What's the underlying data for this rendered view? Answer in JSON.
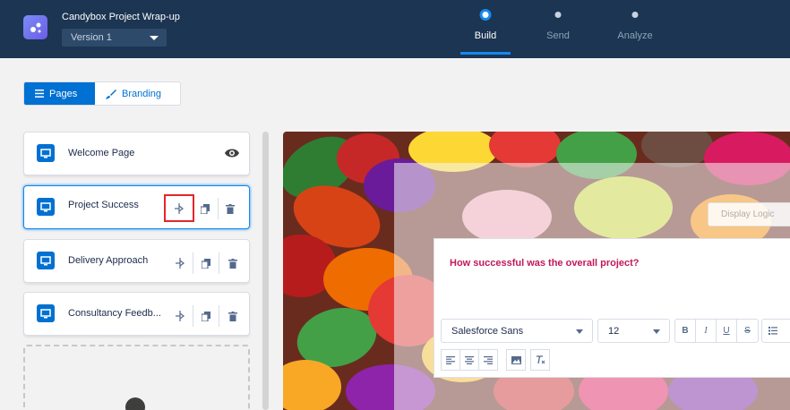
{
  "header": {
    "app_title": "Candybox Project Wrap-up",
    "version": "Version 1",
    "steps": [
      {
        "label": "Build",
        "active": true
      },
      {
        "label": "Send",
        "active": false
      },
      {
        "label": "Analyze",
        "active": false
      }
    ]
  },
  "mode_toggle": {
    "pages_label": "Pages",
    "branding_label": "Branding"
  },
  "pages": [
    {
      "label": "Welcome Page"
    },
    {
      "label": "Project Success"
    },
    {
      "label": "Delivery Approach"
    },
    {
      "label": "Consultancy Feedb..."
    }
  ],
  "canvas": {
    "display_logic_label": "Display Logic",
    "question": "How successful was the overall project?",
    "font": "Salesforce Sans",
    "font_size": "12",
    "format_buttons": [
      "B",
      "I",
      "U",
      "S"
    ]
  },
  "colors": {
    "header_bg": "#1b3552",
    "accent": "#0070d2",
    "question_text": "#c2185b",
    "highlight": "#e3262b"
  }
}
